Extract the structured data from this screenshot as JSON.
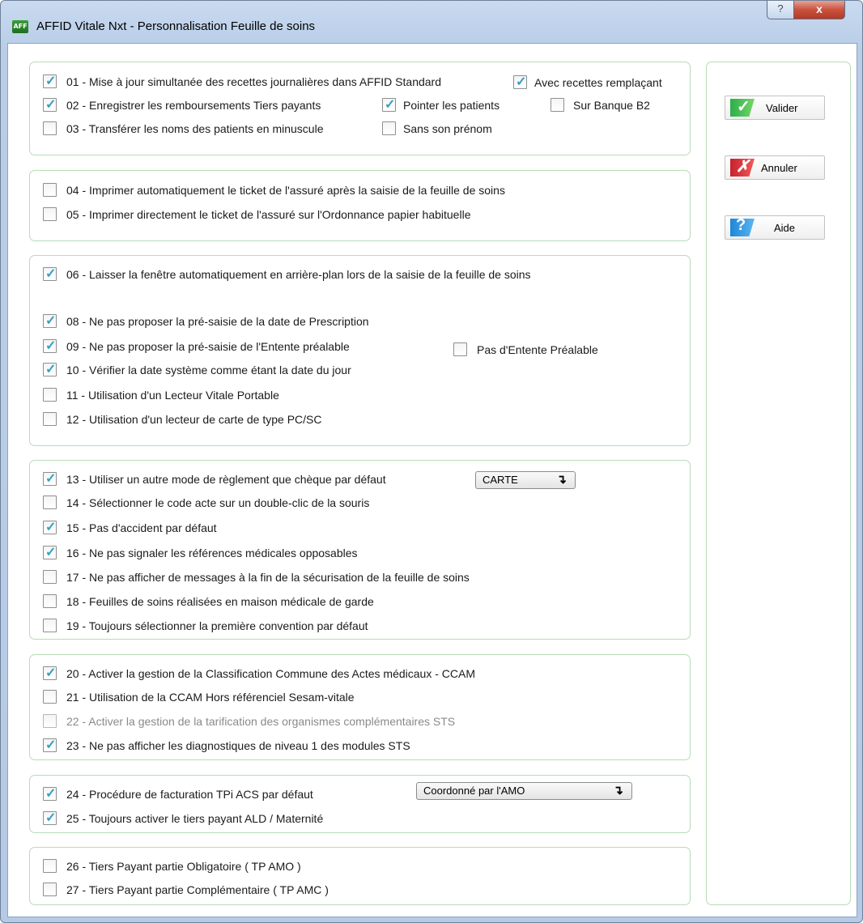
{
  "window": {
    "title": "AFFID Vitale Nxt - Personnalisation Feuille de soins",
    "app_icon_text": "AFF",
    "help_glyph": "?",
    "close_glyph": "x"
  },
  "options": {
    "o01": {
      "label": "01 - Mise à jour simultanée des recettes journalières dans AFFID Standard",
      "checked": true
    },
    "o01b": {
      "label": "Avec recettes remplaçant",
      "checked": true
    },
    "o02": {
      "label": "02 - Enregistrer les remboursements Tiers payants",
      "checked": true
    },
    "o02b": {
      "label": "Pointer les patients",
      "checked": true
    },
    "o02c": {
      "label": "Sur Banque B2",
      "checked": false
    },
    "o03": {
      "label": "03 - Transférer les noms des patients en minuscule",
      "checked": false
    },
    "o03b": {
      "label": "Sans son prénom",
      "checked": false
    },
    "o04": {
      "label": "04 - Imprimer automatiquement le ticket de l'assuré après la saisie de la feuille de soins",
      "checked": false
    },
    "o05": {
      "label": "05 - Imprimer directement le ticket de l'assuré sur l'Ordonnance papier habituelle",
      "checked": false
    },
    "o06": {
      "label": "06 - Laisser la fenêtre automatiquement en arrière-plan lors de la saisie de la feuille de soins",
      "checked": true
    },
    "o08": {
      "label": "08 - Ne pas proposer la pré-saisie de la date de Prescription",
      "checked": true
    },
    "o09": {
      "label": "09 - Ne pas proposer la pré-saisie de l'Entente préalable",
      "checked": true
    },
    "o09b": {
      "label": "Pas d'Entente Préalable",
      "checked": false
    },
    "o10": {
      "label": "10 - Vérifier la date système comme étant la date du jour",
      "checked": true
    },
    "o11": {
      "label": "11 - Utilisation d'un Lecteur Vitale Portable",
      "checked": false
    },
    "o12": {
      "label": "12 - Utilisation d'un lecteur de carte de type PC/SC",
      "checked": false
    },
    "o13": {
      "label": "13 - Utiliser un autre mode de règlement que chèque par défaut",
      "checked": true
    },
    "o14": {
      "label": "14 - Sélectionner le code acte sur un double-clic de la souris",
      "checked": false
    },
    "o15": {
      "label": "15 - Pas d'accident par défaut",
      "checked": true
    },
    "o16": {
      "label": "16 - Ne pas signaler les références médicales opposables",
      "checked": true
    },
    "o17": {
      "label": "17 - Ne pas afficher de messages à la fin de la sécurisation de la feuille de soins",
      "checked": false
    },
    "o18": {
      "label": "18 - Feuilles de soins réalisées en maison médicale de garde",
      "checked": false
    },
    "o19": {
      "label": "19 - Toujours sélectionner la première convention par défaut",
      "checked": false
    },
    "o20": {
      "label": "20 - Activer la gestion de la Classification Commune des Actes médicaux - CCAM",
      "checked": true
    },
    "o21": {
      "label": "21 - Utilisation de la CCAM Hors référenciel Sesam-vitale",
      "checked": false
    },
    "o22": {
      "label": "22 - Activer la gestion de la tarification des organismes complémentaires STS",
      "checked": false,
      "disabled": true
    },
    "o23": {
      "label": "23 - Ne pas afficher les diagnostiques de niveau 1 des modules STS",
      "checked": true
    },
    "o24": {
      "label": "24 - Procédure de facturation TPi ACS par défaut",
      "checked": true
    },
    "o25": {
      "label": "25 - Toujours activer le tiers payant ALD / Maternité",
      "checked": true
    },
    "o26": {
      "label": "26 - Tiers Payant partie Obligatoire ( TP AMO )",
      "checked": false
    },
    "o27": {
      "label": "27 - Tiers Payant partie Complémentaire ( TP AMC )",
      "checked": false
    }
  },
  "combos": {
    "payment_mode": {
      "value": "CARTE"
    },
    "tpi_acs": {
      "value": "Coordonné par l'AMO"
    }
  },
  "buttons": {
    "valider": "Valider",
    "annuler": "Annuler",
    "aide": "Aide"
  },
  "colors": {
    "check": "#35a0c4",
    "group_border": "#b7dcb7",
    "titlebar": "#b9cde8",
    "close": "#c9513d"
  }
}
